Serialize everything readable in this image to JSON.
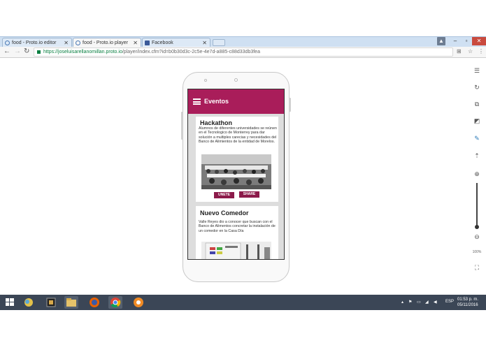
{
  "browser": {
    "tabs": [
      {
        "label": "food - Proto.io editor",
        "icon": "protoio-icon"
      },
      {
        "label": "food - Proto.io player",
        "icon": "protoio-icon",
        "active": true
      },
      {
        "label": "Facebook",
        "icon": "facebook-icon"
      }
    ],
    "url_secure": "https://joseluisarellanomillan.proto.io",
    "url_rest": "/player/index.cfm?id=b0b30d3c-2c5e-4e7d-a885-c88d33db3fea"
  },
  "toolbar": {
    "zoom_label": "100%"
  },
  "app": {
    "title": "Eventos",
    "events": [
      {
        "title": "Hackathon",
        "description": "Alumnos de diferentes universidades se reúnen en el Tecnologico de Monterrey para dar solución a multiples carecias y necesidades del Banco de Alimientos de la entidad de Morelos.",
        "join_label": "UNETE",
        "share_label": "SHARE"
      },
      {
        "title": "Nuevo Comedor",
        "description": "Valle Reyes dio a conocer que buscan con el Banco de Alimentos concretar la instalación de un comedor en la Casa Día"
      }
    ]
  },
  "taskbar": {
    "language": "ESP",
    "time": "01:53 p. m.",
    "date": "05/11/2016"
  },
  "colors": {
    "app_header": "#a91d5a",
    "button": "#8c1a4a",
    "taskbar": "#3b4656",
    "tabbar": "#cfe0f2"
  }
}
